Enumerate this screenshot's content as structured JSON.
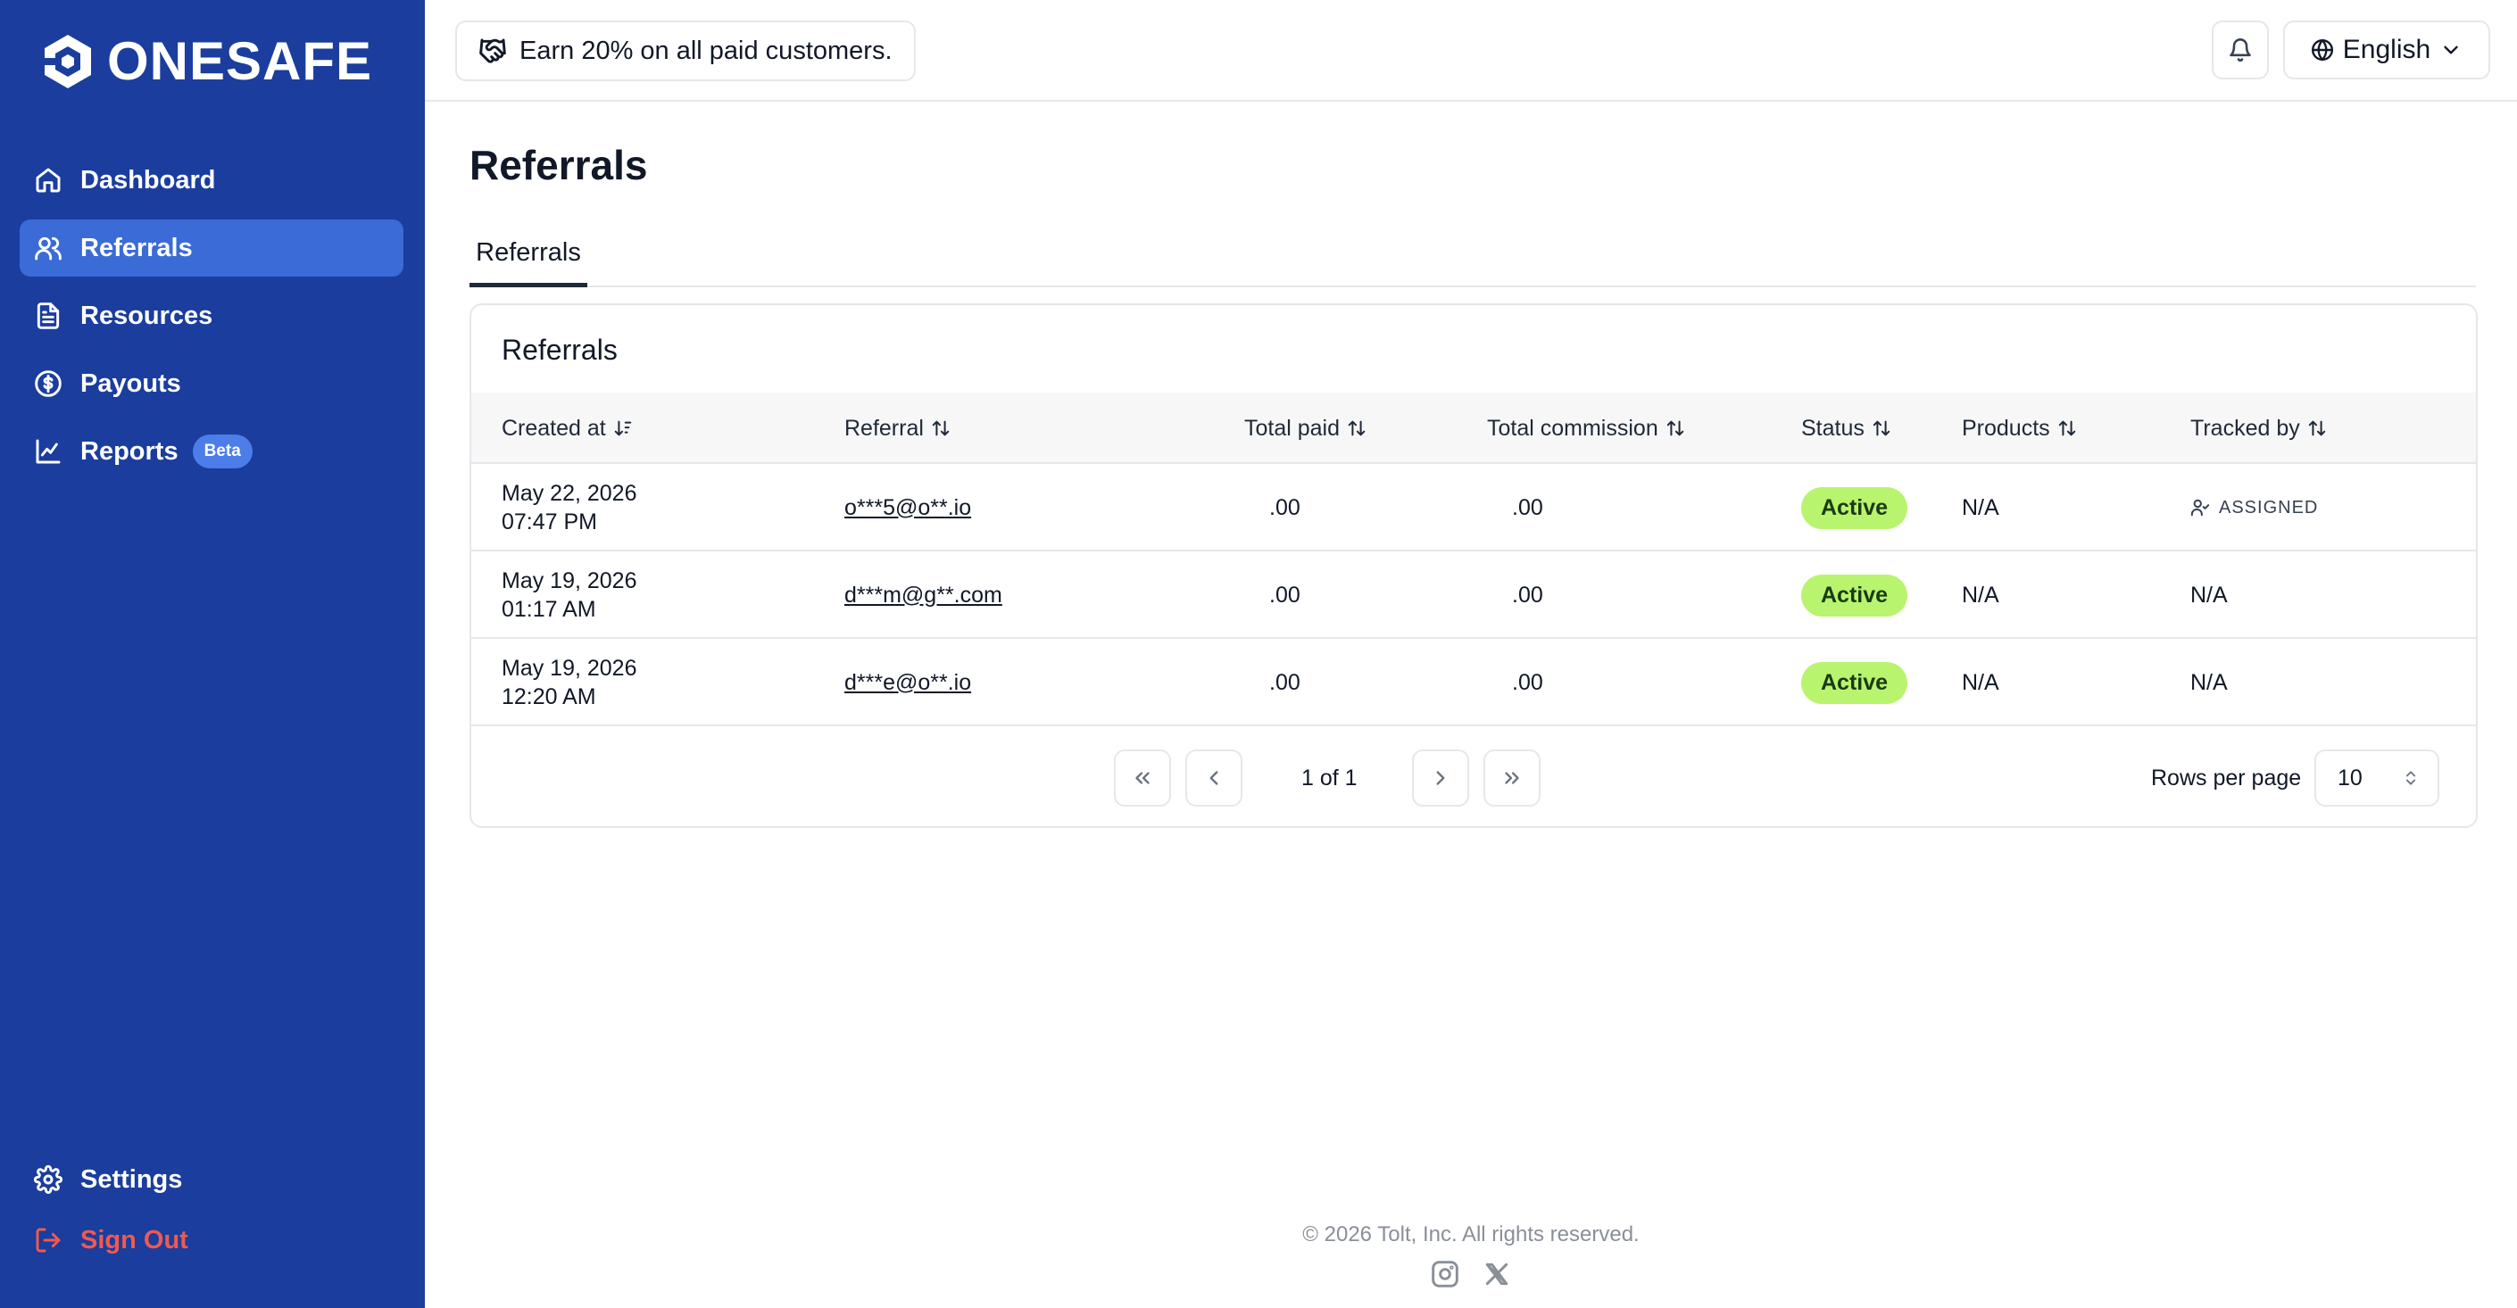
{
  "brand": {
    "name": "ONESAFE",
    "color": "#1a3d9e"
  },
  "sidebar": {
    "items": [
      {
        "label": "Dashboard",
        "icon": "home-icon"
      },
      {
        "label": "Referrals",
        "icon": "users-icon",
        "active": true
      },
      {
        "label": "Resources",
        "icon": "file-text-icon"
      },
      {
        "label": "Payouts",
        "icon": "dollar-circle-icon"
      },
      {
        "label": "Reports",
        "icon": "line-chart-icon",
        "badge": "Beta"
      }
    ],
    "settings_label": "Settings",
    "signout_label": "Sign Out"
  },
  "topbar": {
    "promo": "Earn 20% on all paid customers.",
    "language": "English"
  },
  "page": {
    "title": "Referrals",
    "tab": "Referrals"
  },
  "table": {
    "title": "Referrals",
    "columns": [
      "Created at",
      "Referral",
      "Total paid",
      "Total commission",
      "Status",
      "Products",
      "Tracked by"
    ],
    "rows": [
      {
        "date": "May 22, 2026",
        "time": "07:47 PM",
        "referral": "o***5@o**.io",
        "total_paid": ".00",
        "total_commission": ".00",
        "status": "Active",
        "products": "N/A",
        "tracked_by": "ASSIGNED"
      },
      {
        "date": "May 19, 2026",
        "time": "01:17 AM",
        "referral": "d***m@g**.com",
        "total_paid": ".00",
        "total_commission": ".00",
        "status": "Active",
        "products": "N/A",
        "tracked_by": "N/A"
      },
      {
        "date": "May 19, 2026",
        "time": "12:20 AM",
        "referral": "d***e@o**.io",
        "total_paid": ".00",
        "total_commission": ".00",
        "status": "Active",
        "products": "N/A",
        "tracked_by": "N/A"
      }
    ],
    "status_color": "#b9f46e"
  },
  "pagination": {
    "page_info": "1 of 1",
    "rows_per_page_label": "Rows per page",
    "rows_per_page": "10"
  },
  "footer": {
    "copyright": "© 2026 Tolt, Inc. All rights reserved."
  }
}
